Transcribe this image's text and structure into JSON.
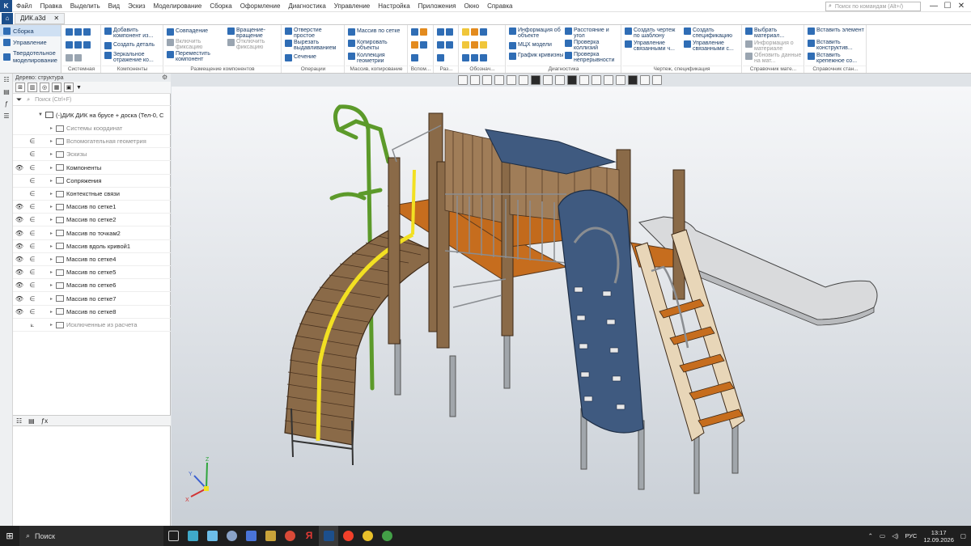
{
  "app": {
    "logo": "K",
    "menu": [
      "Файл",
      "Правка",
      "Выделить",
      "Вид",
      "Эскиз",
      "Моделирование",
      "Сборка",
      "Оформление",
      "Диагностика",
      "Управление",
      "Настройка",
      "Приложения",
      "Окно",
      "Справка"
    ],
    "search_placeholder": "Поиск по командам (Alt+/)",
    "window_buttons": [
      "—",
      "☐",
      "✕"
    ]
  },
  "tabs": {
    "home_icon": "home-icon",
    "document": "ДИК.a3d",
    "close": "✕"
  },
  "ribbon": {
    "modes": [
      "Сборка",
      "Управление",
      "Твердотельное моделирование"
    ],
    "groups": [
      {
        "label": "Системная",
        "commands": [
          "",
          "",
          "",
          "",
          "",
          ""
        ]
      },
      {
        "label": "Компоненты",
        "commands": [
          "Добавить компонент из...",
          "Создать деталь",
          "Зеркальное отражение ко..."
        ]
      },
      {
        "label": "Размещение компонентов",
        "commands": [
          "Совпадение",
          "Вращение-вращение",
          "Включить фиксацию",
          "Отключить фиксацию",
          "Переместить компонент"
        ]
      },
      {
        "label": "Операции",
        "commands": [
          "Отверстие простое",
          "Вырезать выдавливанием",
          "Сечение"
        ]
      },
      {
        "label": "Массив, копирование",
        "commands": [
          "Массив по сетке",
          "Копировать объекты",
          "Коллекция геометрии"
        ]
      },
      {
        "label": "Вспом...",
        "commands": []
      },
      {
        "label": "Раз...",
        "commands": []
      },
      {
        "label": "Обознач...",
        "commands": []
      },
      {
        "label": "Диагностика",
        "commands": [
          "Информация об объекте",
          "МЦХ модели",
          "График кривизны",
          "Расстояние и угол",
          "Проверка коллизий",
          "Проверка непрерывности"
        ]
      },
      {
        "label": "Чертеж, спецификация",
        "commands": [
          "Создать чертеж по шаблону",
          "Управление связанными ч...",
          "Создать спецификацию",
          "Управление связанными с..."
        ]
      },
      {
        "label": "Справочник мате...",
        "commands": [
          "Выбрать материал...",
          "Информация о материале",
          "Обновить данные на мат..."
        ]
      },
      {
        "label": "Справочник стан...",
        "commands": [
          "Вставить элемент",
          "Вставить конструктив...",
          "Вставить крепежное со..."
        ]
      }
    ]
  },
  "tree_panel": {
    "title": "Дерево: структура",
    "search_placeholder": "Поиск (Ctrl+F)",
    "root": "(-)ДИК  ДИК на брусе + доска (Тел-0, С",
    "items": [
      {
        "label": "Системы координат",
        "eye": "",
        "rel": "",
        "dim": true
      },
      {
        "label": "Вспомогательная геометрия",
        "eye": "",
        "rel": "∈",
        "dim": true
      },
      {
        "label": "Эскизы",
        "eye": "",
        "rel": "∈",
        "dim": true
      },
      {
        "label": "Компоненты",
        "eye": "👁",
        "rel": "∈",
        "dim": false
      },
      {
        "label": "Сопряжения",
        "eye": "",
        "rel": "∈",
        "dim": false
      },
      {
        "label": "Контекстные связи",
        "eye": "",
        "rel": "∈",
        "dim": false
      },
      {
        "label": "Массив по сетке1",
        "eye": "👁",
        "rel": "∈",
        "dim": false
      },
      {
        "label": "Массив по сетке2",
        "eye": "👁",
        "rel": "∈",
        "dim": false
      },
      {
        "label": "Массив по точкам2",
        "eye": "👁",
        "rel": "∈",
        "dim": false
      },
      {
        "label": "Массив вдоль кривой1",
        "eye": "👁",
        "rel": "∈",
        "dim": false
      },
      {
        "label": "Массив по сетке4",
        "eye": "👁",
        "rel": "∈",
        "dim": false
      },
      {
        "label": "Массив по сетке5",
        "eye": "👁",
        "rel": "∈",
        "dim": false
      },
      {
        "label": "Массив по сетке6",
        "eye": "👁",
        "rel": "∈",
        "dim": false
      },
      {
        "label": "Массив по сетке7",
        "eye": "👁",
        "rel": "∈",
        "dim": false
      },
      {
        "label": "Массив по сетке8",
        "eye": "👁",
        "rel": "∈",
        "dim": false
      },
      {
        "label": "Исключенные из расчета",
        "eye": "",
        "rel": "⟀",
        "dim": true
      }
    ]
  },
  "viewport": {
    "axes": {
      "x": "X",
      "y": "Y",
      "z": "Z"
    },
    "colors": {
      "wood": "#8a6a48",
      "wood_dark": "#6e4e32",
      "deck": "#c56b1c",
      "panel": "#3f5a80",
      "green": "#5c9a2a",
      "yellow": "#f2e022",
      "metal": "#9ea3a8",
      "slide": "#dcdcdc"
    }
  },
  "taskbar": {
    "search_label": "Поиск",
    "tray": {
      "lang": "РУС",
      "time": "13:17",
      "date": "12.09.2026"
    }
  }
}
